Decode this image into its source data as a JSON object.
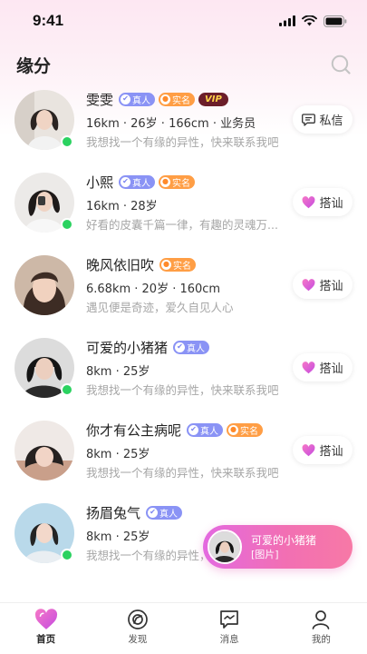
{
  "status_bar": {
    "time": "9:41"
  },
  "header": {
    "title": "缘分",
    "search_icon": "search-icon"
  },
  "users": [
    {
      "name": "雯雯",
      "badges": [
        "真人",
        "实名"
      ],
      "vip": "VIP",
      "stats": "16km · 26岁 · 166cm · 业务员",
      "bio": "我想找一个有缘的异性，快来联系我吧",
      "online": true,
      "action": "私信",
      "action_icon": "chat-bubble-icon"
    },
    {
      "name": "小熙",
      "badges": [
        "真人",
        "实名"
      ],
      "vip": "",
      "stats": "16km · 28岁",
      "bio": "好看的皮囊千篇一律，有趣的灵魂万...",
      "online": true,
      "action": "搭讪",
      "action_icon": "heart-icon"
    },
    {
      "name": "晚风依旧吹",
      "badges": [
        "实名"
      ],
      "vip": "",
      "stats": "6.68km · 20岁 · 160cm",
      "bio": "遇见便是奇迹，爱久自见人心",
      "online": false,
      "action": "搭讪",
      "action_icon": "heart-icon"
    },
    {
      "name": "可爱的小猪猪",
      "badges": [
        "真人"
      ],
      "vip": "",
      "stats": "8km · 25岁",
      "bio": "我想找一个有缘的异性，快来联系我吧",
      "online": true,
      "action": "搭讪",
      "action_icon": "heart-icon"
    },
    {
      "name": "你才有公主病呢",
      "badges": [
        "真人",
        "实名"
      ],
      "vip": "",
      "stats": "8km · 25岁",
      "bio": "我想找一个有缘的异性，快来联系我吧",
      "online": false,
      "action": "搭讪",
      "action_icon": "heart-icon"
    },
    {
      "name": "扬眉兔气",
      "badges": [
        "真人"
      ],
      "vip": "",
      "stats": "8km · 25岁",
      "bio": "我想找一个有缘的异性，快来联系我吧",
      "online": true,
      "action": "",
      "action_icon": ""
    }
  ],
  "message_toast": {
    "sender": "可爱的小猪猪",
    "content": "[图片]"
  },
  "tabbar": [
    {
      "label": "首页",
      "icon": "home-heart-icon",
      "active": true
    },
    {
      "label": "发现",
      "icon": "discover-icon",
      "active": false
    },
    {
      "label": "消息",
      "icon": "message-icon",
      "active": false
    },
    {
      "label": "我的",
      "icon": "profile-icon",
      "active": false
    }
  ],
  "colors": {
    "accent_pink": "#f26fb3",
    "online_green": "#2bd260",
    "badge_real": "#8a93f5",
    "badge_name": "#ff9e45",
    "vip_bg": "#6c1e2a"
  }
}
